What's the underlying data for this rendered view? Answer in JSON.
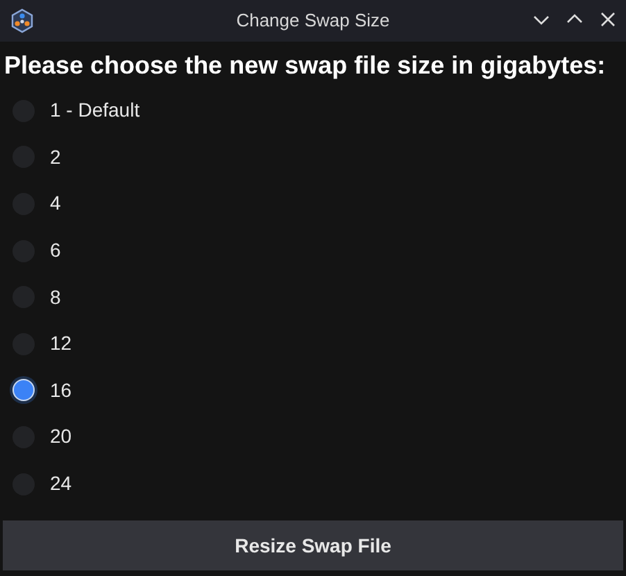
{
  "window": {
    "title": "Change Swap Size"
  },
  "prompt": "Please choose the new swap file size in gigabytes:",
  "options": [
    {
      "label": "1 - Default",
      "selected": false
    },
    {
      "label": "2",
      "selected": false
    },
    {
      "label": "4",
      "selected": false
    },
    {
      "label": "6",
      "selected": false
    },
    {
      "label": "8",
      "selected": false
    },
    {
      "label": "12",
      "selected": false
    },
    {
      "label": "16",
      "selected": true
    },
    {
      "label": "20",
      "selected": false
    },
    {
      "label": "24",
      "selected": false
    }
  ],
  "button": "Resize Swap File"
}
